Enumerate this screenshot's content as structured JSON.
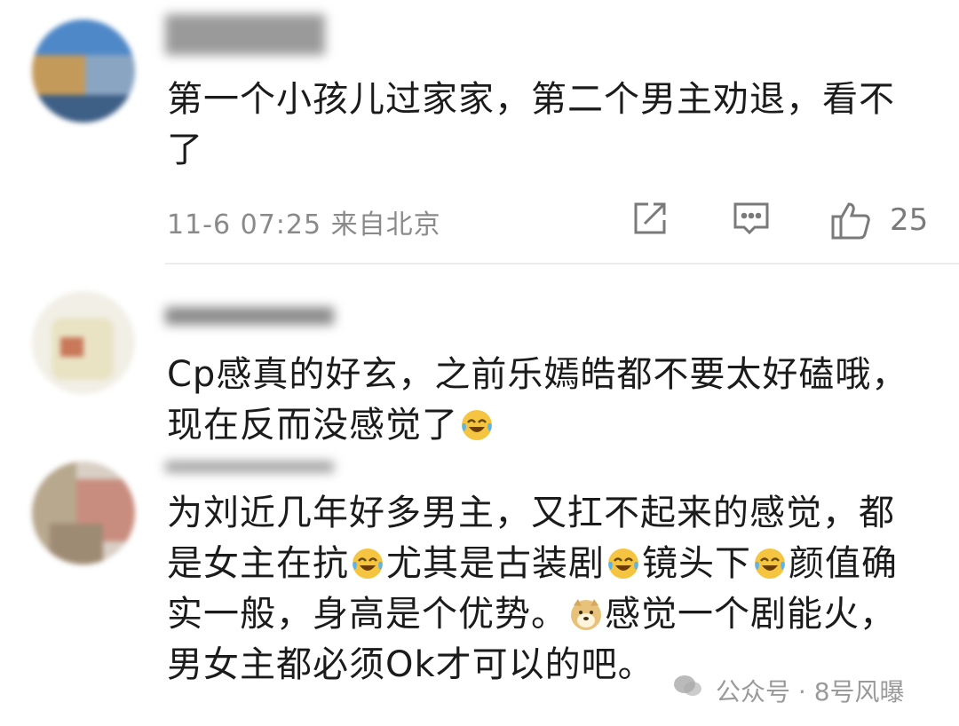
{
  "comments": [
    {
      "text": "第一个小孩儿过家家，第二个男主劝退，看不了",
      "meta": "11-6 07:25 来自北京",
      "likes": "25"
    },
    {
      "text": "Cp感真的好玄，之前乐嫣皓都不要太好磕哦，现在反而没感觉了"
    },
    {
      "text_parts": [
        "为刘近几年好多男主，又扛不起来的感觉，都是女主在抗",
        "尤其是古装剧",
        "镜头下",
        "颜值确实一般，身高是个优势。",
        "感觉一个剧能火，男女主都必须Ok才可以的吧。"
      ]
    }
  ],
  "icons": {
    "share": "share-icon",
    "reply": "comment-icon",
    "like": "thumbs-up-icon",
    "laugh_cry": "laughing-tears-emoji",
    "doge": "doge-emoji",
    "wechat": "wechat-icon"
  },
  "watermark": "公众号 · 8号风曝"
}
